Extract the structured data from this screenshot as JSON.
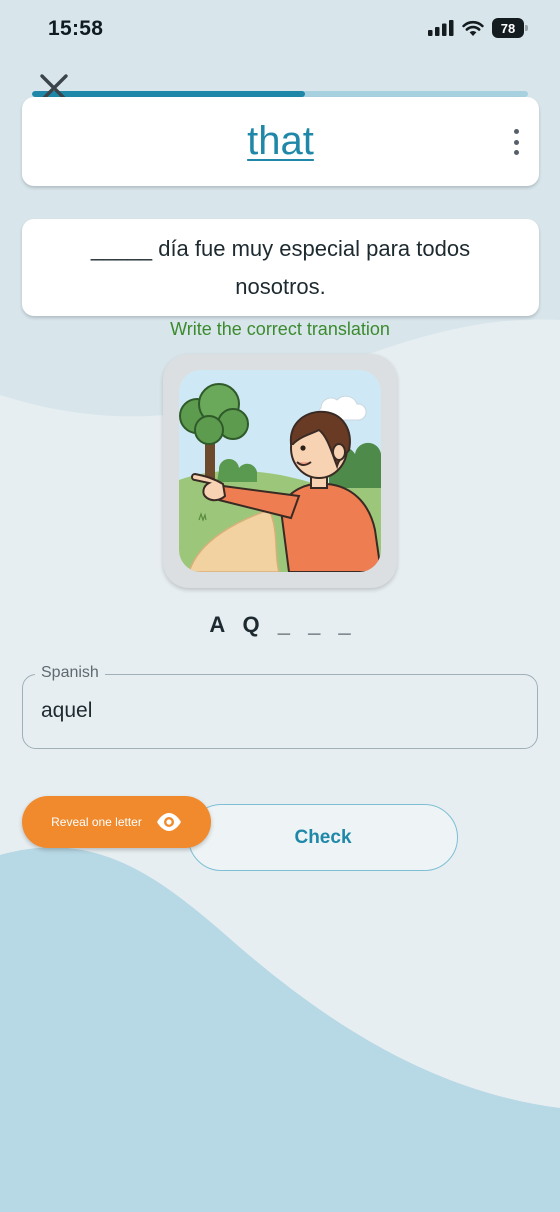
{
  "status_bar": {
    "time": "15:58",
    "battery": "78"
  },
  "progress": {
    "fraction": 0.55
  },
  "word_card": {
    "word": "that"
  },
  "sentence": {
    "text": "_____ día fue muy especial para todos nosotros."
  },
  "instruction": "Write the correct translation",
  "hint": "A Q _ _ _",
  "answer_field": {
    "label": "Spanish",
    "value": "aquel"
  },
  "buttons": {
    "check": "Check",
    "reveal": "Reveal one letter"
  },
  "icons": [
    "close-icon",
    "more-vert-icon",
    "eye-icon",
    "signal-icon",
    "wifi-icon",
    "battery-icon"
  ],
  "colors": {
    "accent": "#1f88a8",
    "reveal": "#f08a2c",
    "instruction": "#3c8a2e",
    "progress_track": "#a7d1df"
  }
}
